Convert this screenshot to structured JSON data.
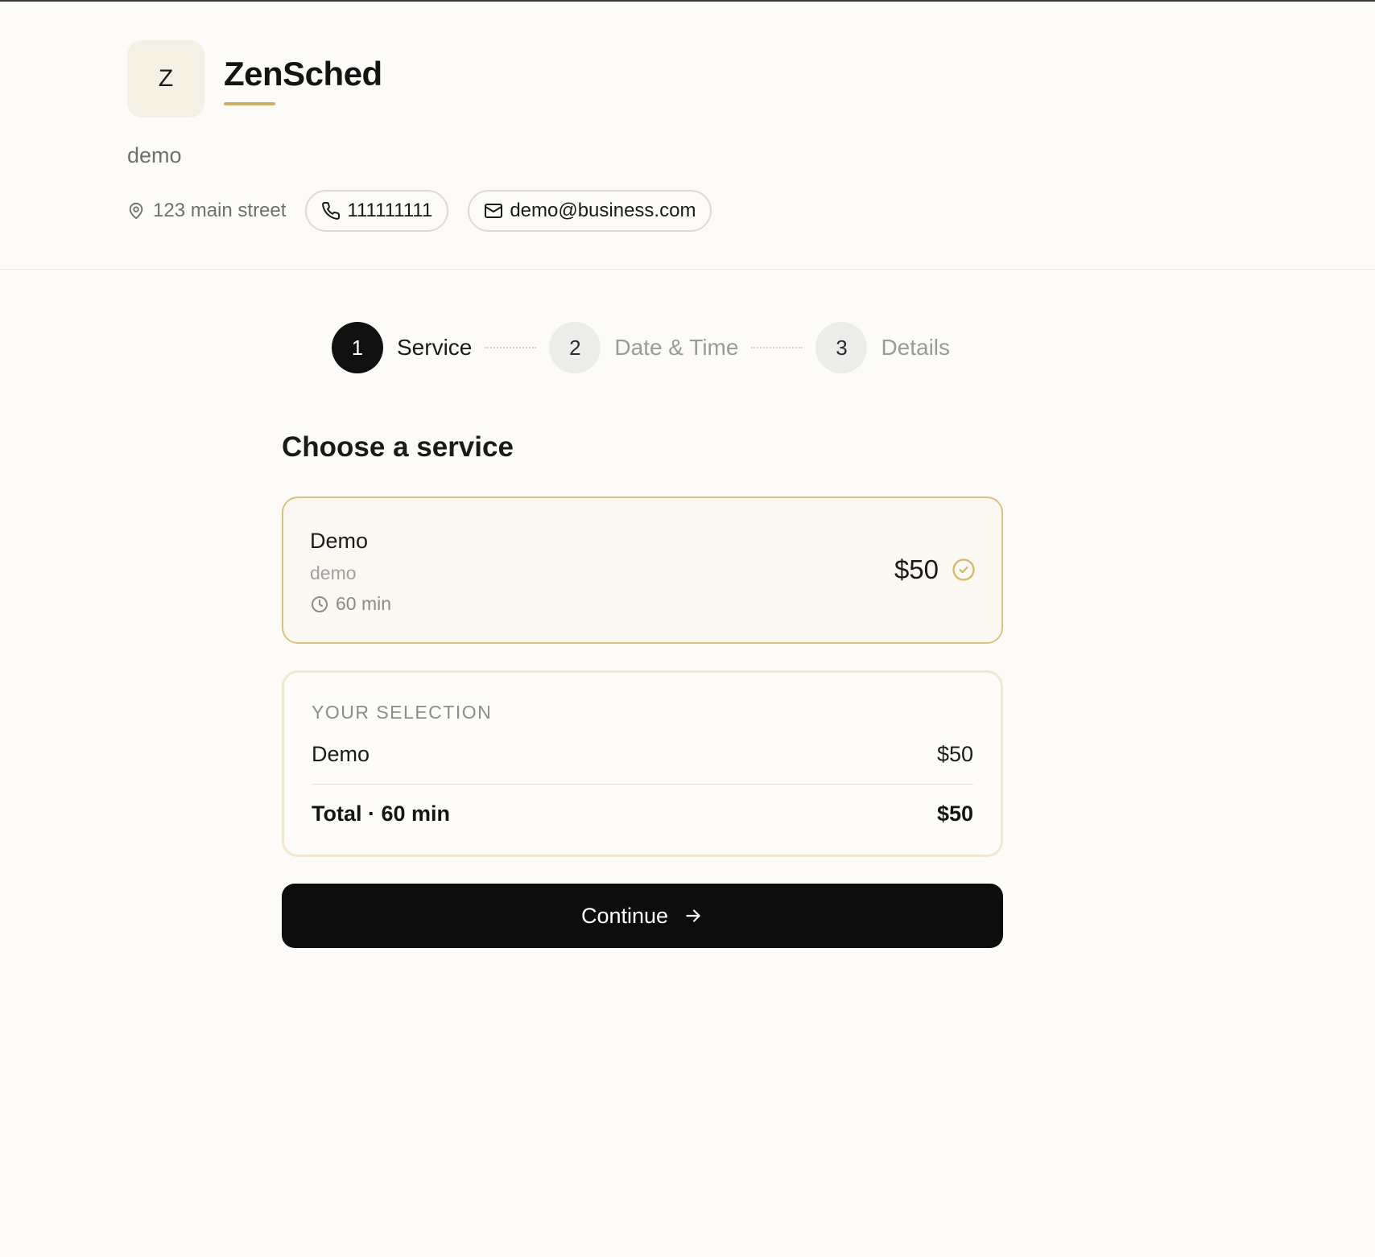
{
  "business": {
    "logo_letter": "Z",
    "name": "ZenSched",
    "tagline": "demo",
    "address": "123 main street",
    "phone": "111111111",
    "email": "demo@business.com"
  },
  "stepper": {
    "steps": [
      {
        "number": "1",
        "label": "Service",
        "state": "active"
      },
      {
        "number": "2",
        "label": "Date & Time",
        "state": "inactive"
      },
      {
        "number": "3",
        "label": "Details",
        "state": "inactive"
      }
    ]
  },
  "main": {
    "title": "Choose a service",
    "service": {
      "name": "Demo",
      "description": "demo",
      "duration": "60 min",
      "price": "$50",
      "selected": true
    },
    "summary": {
      "heading": "YOUR SELECTION",
      "item_name": "Demo",
      "item_price": "$50",
      "total_label": "Total · 60 min",
      "total_price": "$50"
    },
    "continue_label": "Continue"
  },
  "colors": {
    "accent_gold": "#c9b06a",
    "primary_black": "#0d0d0d",
    "background": "#fcfbf7"
  }
}
